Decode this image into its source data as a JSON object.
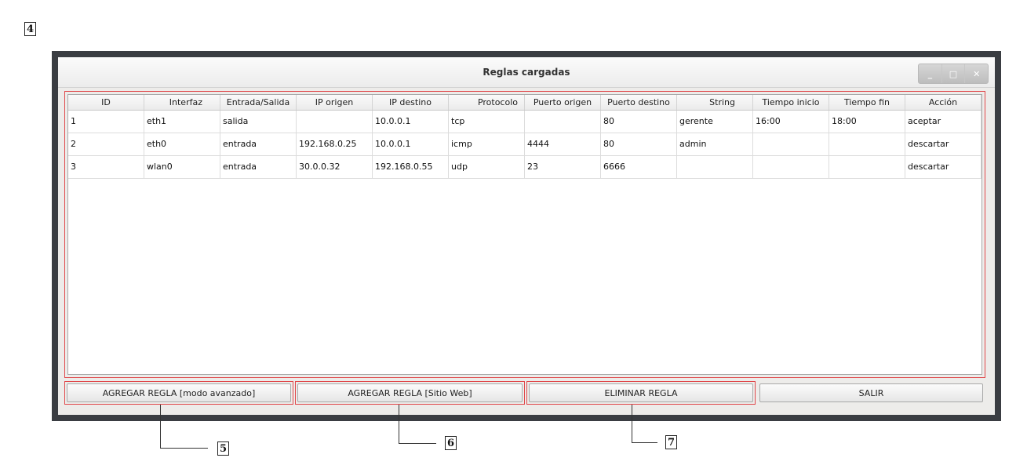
{
  "annotations": {
    "window": "4",
    "advanced_button": "5",
    "web_button": "6",
    "delete_button": "7"
  },
  "window": {
    "title": "Reglas cargadas",
    "controls": {
      "minimize": "_",
      "maximize": "□",
      "close": "✕"
    }
  },
  "table": {
    "columns": [
      "ID",
      "Interfaz",
      "Entrada/Salida",
      "IP origen",
      "IP destino",
      "Protocolo",
      "Puerto origen",
      "Puerto destino",
      "String",
      "Tiempo inicio",
      "Tiempo fin",
      "Acción"
    ],
    "rows": [
      [
        "1",
        "eth1",
        "salida",
        "",
        "10.0.0.1",
        "tcp",
        "",
        "80",
        "gerente",
        "16:00",
        "18:00",
        "aceptar"
      ],
      [
        "2",
        "eth0",
        "entrada",
        "192.168.0.25",
        "10.0.0.1",
        "icmp",
        "4444",
        "80",
        "admin",
        "",
        "",
        "descartar"
      ],
      [
        "3",
        "wlan0",
        "entrada",
        "30.0.0.32",
        "192.168.0.55",
        "udp",
        "23",
        "6666",
        "",
        "",
        "",
        "descartar"
      ]
    ]
  },
  "buttons": {
    "add_advanced": "AGREGAR REGLA [modo avanzado]",
    "add_web": "AGREGAR REGLA [Sitio Web]",
    "delete": "ELIMINAR REGLA",
    "exit": "SALIR"
  },
  "colors": {
    "highlight": "#e0474a",
    "window_frame": "#3a3d42",
    "client_bg": "#edecea"
  }
}
